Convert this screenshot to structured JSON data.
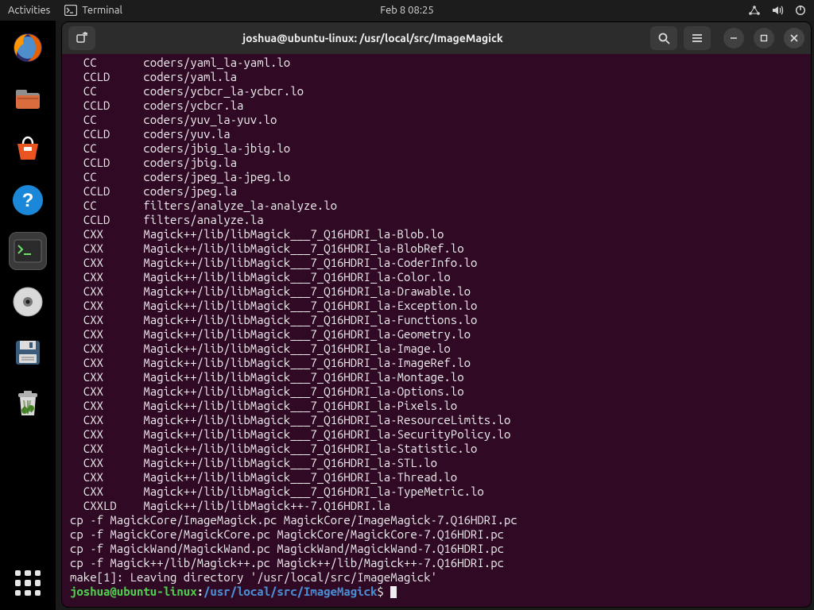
{
  "topbar": {
    "activities": "Activities",
    "app_label": "Terminal",
    "clock": "Feb 8  08:25"
  },
  "window": {
    "title": "joshua@ubuntu-linux: /usr/local/src/ImageMagick"
  },
  "prompt": {
    "userhost": "joshua@ubuntu-linux",
    "colon": ":",
    "cwd": "/usr/local/src/ImageMagick",
    "dollar": "$ "
  },
  "lines": [
    "  CC       coders/yaml_la-yaml.lo",
    "  CCLD     coders/yaml.la",
    "  CC       coders/ycbcr_la-ycbcr.lo",
    "  CCLD     coders/ycbcr.la",
    "  CC       coders/yuv_la-yuv.lo",
    "  CCLD     coders/yuv.la",
    "  CC       coders/jbig_la-jbig.lo",
    "  CCLD     coders/jbig.la",
    "  CC       coders/jpeg_la-jpeg.lo",
    "  CCLD     coders/jpeg.la",
    "  CC       filters/analyze_la-analyze.lo",
    "  CCLD     filters/analyze.la",
    "  CXX      Magick++/lib/libMagick___7_Q16HDRI_la-Blob.lo",
    "  CXX      Magick++/lib/libMagick___7_Q16HDRI_la-BlobRef.lo",
    "  CXX      Magick++/lib/libMagick___7_Q16HDRI_la-CoderInfo.lo",
    "  CXX      Magick++/lib/libMagick___7_Q16HDRI_la-Color.lo",
    "  CXX      Magick++/lib/libMagick___7_Q16HDRI_la-Drawable.lo",
    "  CXX      Magick++/lib/libMagick___7_Q16HDRI_la-Exception.lo",
    "  CXX      Magick++/lib/libMagick___7_Q16HDRI_la-Functions.lo",
    "  CXX      Magick++/lib/libMagick___7_Q16HDRI_la-Geometry.lo",
    "  CXX      Magick++/lib/libMagick___7_Q16HDRI_la-Image.lo",
    "  CXX      Magick++/lib/libMagick___7_Q16HDRI_la-ImageRef.lo",
    "  CXX      Magick++/lib/libMagick___7_Q16HDRI_la-Montage.lo",
    "  CXX      Magick++/lib/libMagick___7_Q16HDRI_la-Options.lo",
    "  CXX      Magick++/lib/libMagick___7_Q16HDRI_la-Pixels.lo",
    "  CXX      Magick++/lib/libMagick___7_Q16HDRI_la-ResourceLimits.lo",
    "  CXX      Magick++/lib/libMagick___7_Q16HDRI_la-SecurityPolicy.lo",
    "  CXX      Magick++/lib/libMagick___7_Q16HDRI_la-Statistic.lo",
    "  CXX      Magick++/lib/libMagick___7_Q16HDRI_la-STL.lo",
    "  CXX      Magick++/lib/libMagick___7_Q16HDRI_la-Thread.lo",
    "  CXX      Magick++/lib/libMagick___7_Q16HDRI_la-TypeMetric.lo",
    "  CXXLD    Magick++/lib/libMagick++-7.Q16HDRI.la",
    "cp -f MagickCore/ImageMagick.pc MagickCore/ImageMagick-7.Q16HDRI.pc",
    "cp -f MagickCore/MagickCore.pc MagickCore/MagickCore-7.Q16HDRI.pc",
    "cp -f MagickWand/MagickWand.pc MagickWand/MagickWand-7.Q16HDRI.pc",
    "cp -f Magick++/lib/Magick++.pc Magick++/lib/Magick++-7.Q16HDRI.pc",
    "make[1]: Leaving directory '/usr/local/src/ImageMagick'"
  ]
}
